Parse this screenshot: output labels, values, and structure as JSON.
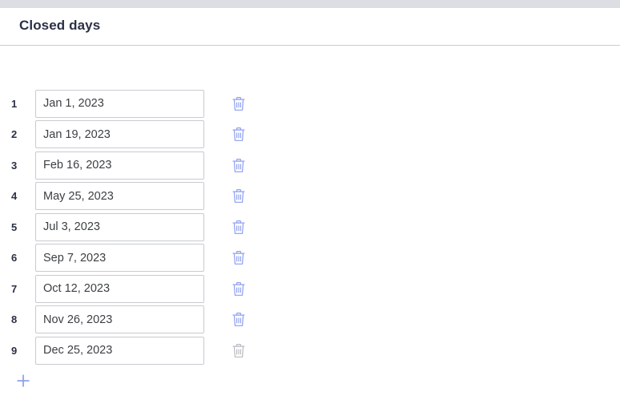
{
  "window": {
    "top_strip_color": "#dcdee3"
  },
  "header": {
    "title": "Closed days",
    "divider_color": "#c9ccd1"
  },
  "colors": {
    "accent_blue": "#8c9eef",
    "disabled_gray": "#b6b9be",
    "input_border": "#c8cbd0",
    "text_dark": "#2b3045",
    "input_text": "#3c4043"
  },
  "icons": {
    "delete": "trash-icon",
    "add": "plus-icon"
  },
  "list": {
    "input_placeholder": "",
    "rows": [
      {
        "index": "1",
        "date": "Jan 1, 2023",
        "delete_state": "enabled"
      },
      {
        "index": "2",
        "date": "Jan 19, 2023",
        "delete_state": "enabled"
      },
      {
        "index": "3",
        "date": "Feb 16, 2023",
        "delete_state": "enabled"
      },
      {
        "index": "4",
        "date": "May 25, 2023",
        "delete_state": "enabled"
      },
      {
        "index": "5",
        "date": "Jul 3, 2023",
        "delete_state": "enabled"
      },
      {
        "index": "6",
        "date": "Sep 7, 2023",
        "delete_state": "enabled"
      },
      {
        "index": "7",
        "date": "Oct 12, 2023",
        "delete_state": "enabled"
      },
      {
        "index": "8",
        "date": "Nov 26, 2023",
        "delete_state": "enabled"
      },
      {
        "index": "9",
        "date": "Dec 25, 2023",
        "delete_state": "hover"
      }
    ]
  },
  "add_button": {
    "label": "+"
  }
}
